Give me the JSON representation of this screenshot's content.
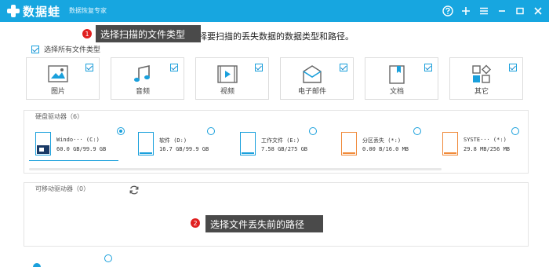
{
  "app": {
    "logo_text": "数据蛙",
    "subtitle": "数据恢复专家",
    "brand_color": "#17a6e0"
  },
  "window_controls": {
    "icons": [
      "help-icon",
      "plus-icon",
      "menu-icon",
      "minimize-icon",
      "maximize-icon",
      "close-icon"
    ]
  },
  "instruction": "择要扫描的丢失数据的数据类型和路径。",
  "select_all": {
    "label": "选择所有文件类型",
    "checked": true
  },
  "file_types": [
    {
      "label": "图片",
      "icon": "image-icon",
      "checked": true
    },
    {
      "label": "音频",
      "icon": "music-icon",
      "checked": true
    },
    {
      "label": "视频",
      "icon": "video-icon",
      "checked": true
    },
    {
      "label": "电子邮件",
      "icon": "email-icon",
      "checked": true
    },
    {
      "label": "文档",
      "icon": "document-icon",
      "checked": true
    },
    {
      "label": "其它",
      "icon": "other-icon",
      "checked": true
    }
  ],
  "hard_drives": {
    "title": "硬盘驱动器（6）",
    "drives": [
      {
        "name": "Windo··· (C:)",
        "size": "60.0 GB/99.9 GB",
        "color": "#1a3a66",
        "selected": true
      },
      {
        "name": "软件 (D:)",
        "size": "16.7 GB/99.9 GB",
        "color": "#1aa0dc",
        "selected": false
      },
      {
        "name": "工作文件 (E:)",
        "size": "7.58 GB/275 GB",
        "color": "#1aa0dc",
        "selected": false
      },
      {
        "name": "分区丢失 (*:)",
        "size": "0.00  B/16.0 MB",
        "color": "#f08a3a",
        "selected": false
      },
      {
        "name": "SYSTE··· (*:)",
        "size": "29.8 MB/256 MB",
        "color": "#f08a3a",
        "selected": false
      }
    ]
  },
  "removable_drives": {
    "title": "可移动驱动器（0）"
  },
  "callouts": [
    {
      "number": "1",
      "text": "选择扫描的文件类型"
    },
    {
      "number": "2",
      "text": "选择文件丢失前的路径"
    }
  ]
}
